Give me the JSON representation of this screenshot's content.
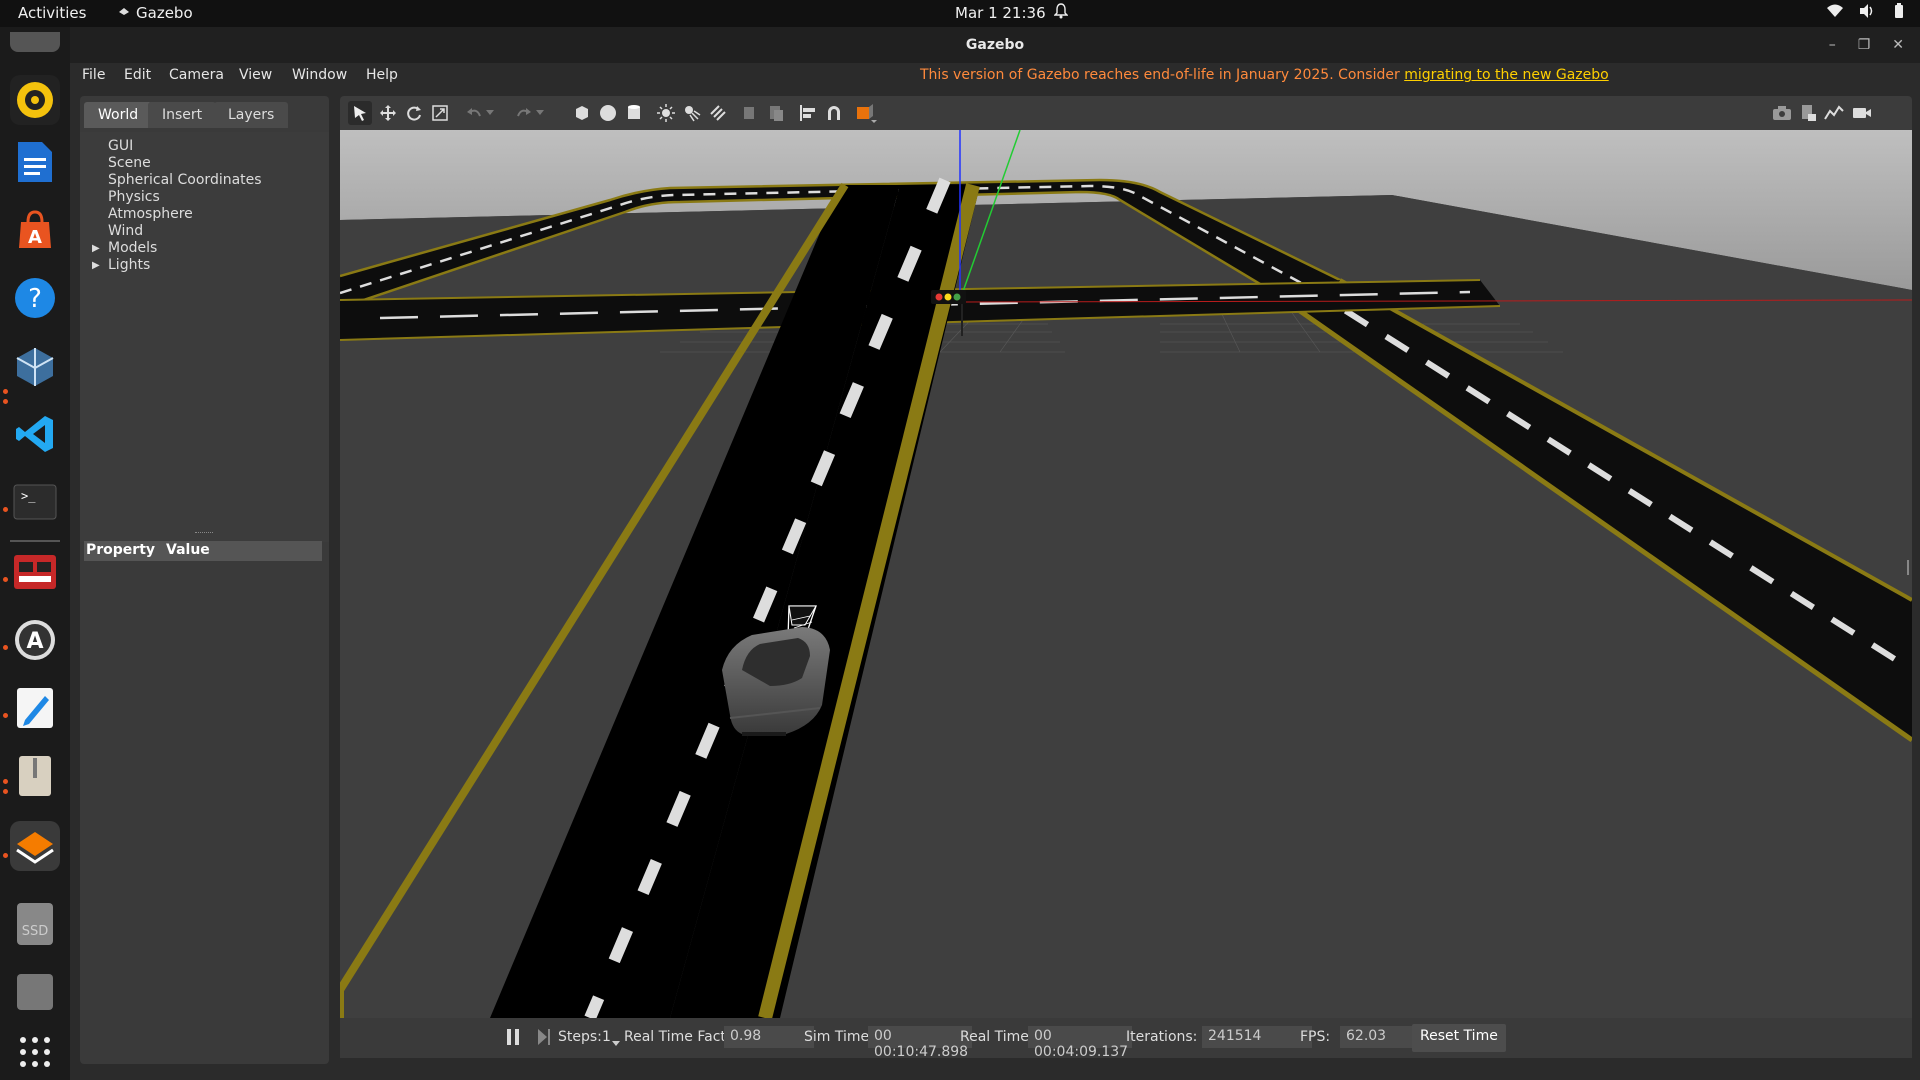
{
  "system": {
    "activities": "Activities",
    "app_name": "Gazebo",
    "clock": "Mar 1  21:36"
  },
  "window": {
    "title": "Gazebo",
    "menus": [
      "File",
      "Edit",
      "Camera",
      "View",
      "Window",
      "Help"
    ],
    "eol_notice": "This version of Gazebo reaches end-of-life in January 2025. Consider ",
    "eol_link": "migrating to the new Gazebo"
  },
  "left_panel": {
    "tabs": [
      "World",
      "Insert",
      "Layers"
    ],
    "tree": [
      "GUI",
      "Scene",
      "Spherical Coordinates",
      "Physics",
      "Atmosphere",
      "Wind",
      "Models",
      "Lights"
    ],
    "prop_header": {
      "property": "Property",
      "value": "Value"
    }
  },
  "status": {
    "steps_label": "Steps:",
    "steps_value": "1",
    "rtf_label": "Real Time Factor:",
    "rtf_value": "0.98",
    "sim_label": "Sim Time:",
    "sim_value": "00 00:10:47.898",
    "real_label": "Real Time:",
    "real_value": "00 00:04:09.137",
    "iter_label": "Iterations:",
    "iter_value": "241514",
    "fps_label": "FPS:",
    "fps_value": "62.03",
    "reset_label": "Reset Time"
  },
  "dock_icons": [
    "rhythmbox-icon",
    "writer-icon",
    "app-center-icon",
    "help-icon",
    "virtualbox-icon",
    "vscode-icon",
    "terminal-icon",
    "red-app-icon",
    "software-updater-icon",
    "text-editor-icon",
    "archive-icon",
    "gazebo-icon",
    "ssd-drive-icon",
    "ssd-drive-icon",
    "app-grid-icon"
  ],
  "ssd_label": "SSD",
  "colors": {
    "accent": "#e95420",
    "eol_text": "#ff8a3c",
    "eol_link": "#ffd000",
    "road_line": "#8a7a14"
  }
}
